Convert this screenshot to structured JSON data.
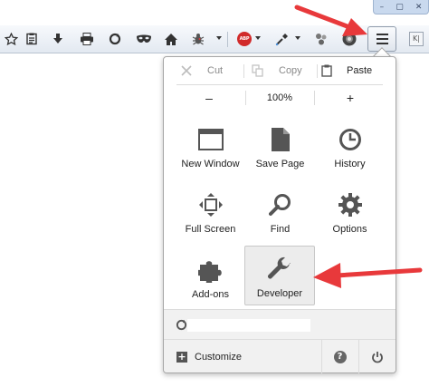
{
  "window": {
    "buttons": [
      "–",
      "▢",
      "✕"
    ]
  },
  "toolbar": {
    "abp_label": "ABP",
    "sidebar_glyph": "K|"
  },
  "menu": {
    "edit": {
      "cut": "Cut",
      "copy": "Copy",
      "paste": "Paste"
    },
    "zoom": {
      "minus": "–",
      "level": "100%",
      "plus": "+"
    },
    "tiles": [
      {
        "label": "New Window",
        "icon": "new-window-icon"
      },
      {
        "label": "Save Page",
        "icon": "save-page-icon"
      },
      {
        "label": "History",
        "icon": "history-icon"
      },
      {
        "label": "Full Screen",
        "icon": "full-screen-icon"
      },
      {
        "label": "Find",
        "icon": "find-icon"
      },
      {
        "label": "Options",
        "icon": "options-icon"
      },
      {
        "label": "Add-ons",
        "icon": "add-ons-icon"
      },
      {
        "label": "Developer",
        "icon": "developer-icon"
      }
    ],
    "footer": {
      "customize": "Customize",
      "help_glyph": "?"
    }
  },
  "colors": {
    "annotation_arrow": "#e8393b",
    "panel_footer": "#f1f1f1",
    "active_tile": "#ececec"
  }
}
